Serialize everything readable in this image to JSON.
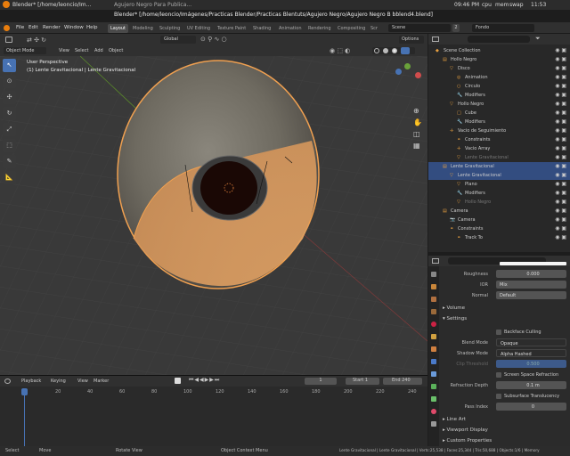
{
  "sysbar": {
    "app": "Blender* [/home/leoncio/Im...",
    "tab2": "Agujero Negro Para Publica...",
    "clock": "09:46 PM",
    "cpu": "cpu",
    "mem": "mem",
    "swap": "swap",
    "time2": "11:53"
  },
  "title": "Blender* [/home/leoncio/Imágenes/Practicas Blender/Practicas Blentuts/Agujero Negro/Agujero Negro B bblend4.blend]",
  "menu": [
    "File",
    "Edit",
    "Render",
    "Window",
    "Help"
  ],
  "workspaces": [
    "Layout",
    "Modeling",
    "Sculpting",
    "UV Editing",
    "Texture Paint",
    "Shading",
    "Animation",
    "Rendering",
    "Compositing",
    "Scr"
  ],
  "scene": {
    "label": "Scene",
    "count": "2",
    "layer": "Fondo"
  },
  "header3d": {
    "orient": "Global",
    "options": "Options",
    "mode": "Object Mode",
    "view": "View",
    "select": "Select",
    "add": "Add",
    "object": "Object"
  },
  "viewport": {
    "persp": "User Perspective",
    "obj": "(1) Lente Gravitacional | Lente Gravitacional"
  },
  "outliner": [
    {
      "t": "Scene Collection",
      "d": 0
    },
    {
      "t": "Hollo Negro",
      "d": 1
    },
    {
      "t": "Disco",
      "d": 2
    },
    {
      "t": "Animation",
      "d": 3
    },
    {
      "t": "Circulo",
      "d": 3
    },
    {
      "t": "Modifiers",
      "d": 3
    },
    {
      "t": "Hollo Negro",
      "d": 2
    },
    {
      "t": "Cube",
      "d": 3
    },
    {
      "t": "Modifiers",
      "d": 3
    },
    {
      "t": "Vacio de Seguimiento",
      "d": 2
    },
    {
      "t": "Constraints",
      "d": 3
    },
    {
      "t": "Vacio Array",
      "d": 3
    },
    {
      "t": "Lente Gravitacional",
      "d": 3
    },
    {
      "t": "Lente Gravitacional",
      "d": 1
    },
    {
      "t": "Lente Gravitacional",
      "d": 2
    },
    {
      "t": "Plano",
      "d": 3
    },
    {
      "t": "Modifiers",
      "d": 3
    },
    {
      "t": "Hollo Negro",
      "d": 3
    },
    {
      "t": "Camera",
      "d": 1
    },
    {
      "t": "Camera",
      "d": 2
    },
    {
      "t": "Constraints",
      "d": 2
    },
    {
      "t": "Track To",
      "d": 3
    }
  ],
  "props": {
    "roughness_l": "Roughness",
    "roughness_v": "0.000",
    "ior_l": "IOR",
    "ior_v": "Mix",
    "normal_l": "Normal",
    "normal_v": "Default",
    "volume": "Volume",
    "settings": "Settings",
    "backface": "Backface Culling",
    "blend_l": "Blend Mode",
    "blend_v": "Opaque",
    "shadow_l": "Shadow Mode",
    "shadow_v": "Alpha Hashed",
    "clip_l": "Clip Threshold",
    "clip_v": "0.500",
    "ssr": "Screen Space Refraction",
    "refr_l": "Refraction Depth",
    "refr_v": "0.1 m",
    "sst": "Subsurface Translucency",
    "pass_l": "Pass Index",
    "pass_v": "0",
    "lineart": "Line Art",
    "vpdisp": "Viewport Display",
    "custom": "Custom Properties"
  },
  "timeline": {
    "playback": "Playback",
    "keying": "Keying",
    "view": "View",
    "marker": "Marker",
    "current": "1",
    "start_l": "Start",
    "start": "1",
    "end_l": "End",
    "end": "240",
    "ticks": [
      "1",
      "20",
      "40",
      "60",
      "80",
      "100",
      "120",
      "140",
      "160",
      "180",
      "200",
      "220",
      "240"
    ]
  },
  "status": {
    "select": "Select",
    "move": "Move",
    "rotate": "Rotate View",
    "ctx": "Object Context Menu",
    "info": "Lente Gravitacional | Lente Gravitacional | Verts:25,538 | Faces:25,344 | Tris:50,688 | Objects:1/6 | Memory"
  },
  "accent": "#4772b3",
  "orange": "#f0a050"
}
